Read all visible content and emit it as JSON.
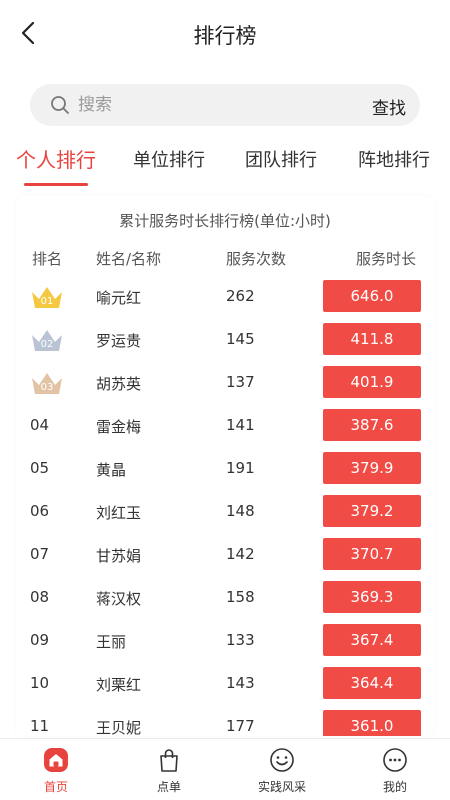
{
  "header": {
    "title": "排行榜"
  },
  "search": {
    "placeholder": "搜索",
    "button_label": "查找"
  },
  "tabs": [
    {
      "label": "个人排行",
      "active": true
    },
    {
      "label": "单位排行",
      "active": false
    },
    {
      "label": "团队排行",
      "active": false
    },
    {
      "label": "阵地排行",
      "active": false
    }
  ],
  "ranking": {
    "subtitle": "累计服务时长排行榜(单位:小时)",
    "columns": {
      "rank": "排名",
      "name": "姓名/名称",
      "count": "服务次数",
      "hours": "服务时长"
    },
    "rows": [
      {
        "rank": "01",
        "name": "喻元红",
        "count": "262",
        "hours": "646.0",
        "medal": "gold"
      },
      {
        "rank": "02",
        "name": "罗运贵",
        "count": "145",
        "hours": "411.8",
        "medal": "silver"
      },
      {
        "rank": "03",
        "name": "胡苏英",
        "count": "137",
        "hours": "401.9",
        "medal": "bronze"
      },
      {
        "rank": "04",
        "name": "雷金梅",
        "count": "141",
        "hours": "387.6"
      },
      {
        "rank": "05",
        "name": "黄晶",
        "count": "191",
        "hours": "379.9"
      },
      {
        "rank": "06",
        "name": "刘红玉",
        "count": "148",
        "hours": "379.2"
      },
      {
        "rank": "07",
        "name": "甘苏娟",
        "count": "142",
        "hours": "370.7"
      },
      {
        "rank": "08",
        "name": "蒋汉权",
        "count": "158",
        "hours": "369.3"
      },
      {
        "rank": "09",
        "name": "王丽",
        "count": "133",
        "hours": "367.4"
      },
      {
        "rank": "10",
        "name": "刘栗红",
        "count": "143",
        "hours": "364.4"
      },
      {
        "rank": "11",
        "name": "王贝妮",
        "count": "177",
        "hours": "361.0"
      }
    ]
  },
  "tabbar": [
    {
      "label": "首页",
      "icon": "home-icon",
      "active": true
    },
    {
      "label": "点单",
      "icon": "shopping-bag-icon",
      "active": false
    },
    {
      "label": "实践风采",
      "icon": "smiley-icon",
      "active": false
    },
    {
      "label": "我的",
      "icon": "chat-dots-icon",
      "active": false
    }
  ],
  "colors": {
    "accent": "#e8433d",
    "bar": "#f14b45",
    "gold": "#f5c842",
    "silver": "#b9c3d4",
    "bronze": "#e2c3a6"
  }
}
